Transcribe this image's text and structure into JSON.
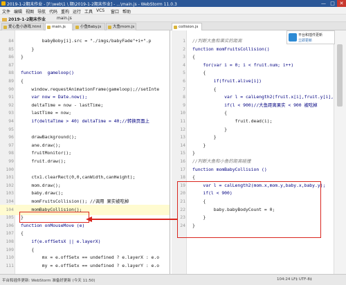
{
  "window": {
    "title": "2019-1-2期末作业 - [F:\\web\\1 \\ 期\\2019-1-2期末作业] - ...\\main.js - WebStorm 11.0.3",
    "minimize": "—",
    "maximize": "□",
    "close": "✕"
  },
  "menu": [
    "文件",
    "编辑",
    "视图",
    "导航",
    "代码",
    "重构",
    "运行",
    "工具",
    "VCS",
    "窗口",
    "帮助"
  ],
  "toolbar": {
    "project": "2019-1-2期末作业",
    "file": "main.js"
  },
  "tabs": [
    {
      "label": "爱心鱼小游戏.html",
      "active": false
    },
    {
      "label": "main.js",
      "active": true
    },
    {
      "label": "小鱼Baby.js",
      "active": false
    },
    {
      "label": "大鱼mom.js",
      "active": false
    },
    {
      "label": "collision.js",
      "active": true
    }
  ],
  "left_code": [
    {
      "n": "84",
      "t": "        babyBoby[i].src = \"./imgs/babyFade\"+i+\".p"
    },
    {
      "n": "85",
      "t": "    }"
    },
    {
      "n": "86",
      "t": "}"
    },
    {
      "n": "87",
      "t": ""
    },
    {
      "n": "88",
      "t": "function  gameloop()"
    },
    {
      "n": "89",
      "t": "{"
    },
    {
      "n": "90",
      "t": "    window.requestAnimationFrame(gameloop);//setInte"
    },
    {
      "n": "91",
      "t": "    var now = Date.now();"
    },
    {
      "n": "92",
      "t": "    deltaTime = now - lastTime;"
    },
    {
      "n": "93",
      "t": "    lastTime = now;"
    },
    {
      "n": "94",
      "t": "    if(deltaTime > 40) deltaTime = 40;//转换页面上"
    },
    {
      "n": "95",
      "t": ""
    },
    {
      "n": "96",
      "t": "    drawBackground();"
    },
    {
      "n": "97",
      "t": "    ane.draw();"
    },
    {
      "n": "98",
      "t": "    fruitMonitor();"
    },
    {
      "n": "99",
      "t": "    fruit.draw();"
    },
    {
      "n": "100",
      "t": ""
    },
    {
      "n": "101",
      "t": "    ctx1.clearRect(0,0,canWidth,canHeight);"
    },
    {
      "n": "102",
      "t": "    mom.draw();"
    },
    {
      "n": "103",
      "t": "    baby.draw();"
    },
    {
      "n": "104",
      "t": "    momFruitsCollision(); //调用 果实被吃掉"
    },
    {
      "n": "104",
      "t": "    momBabyCollision();"
    },
    {
      "n": "105",
      "t": "}"
    },
    {
      "n": "106",
      "t": "function onMouseMove (e)"
    },
    {
      "n": "107",
      "t": "{"
    },
    {
      "n": "108",
      "t": "    if(e.offSetsX || e.layerX)"
    },
    {
      "n": "109",
      "t": "    {"
    },
    {
      "n": "110",
      "t": "        mx = e.offSetx == undefined ? e.layerX : e.o"
    },
    {
      "n": "111",
      "t": "        my = e.offSetx == undefined ? e.layerY : e.o"
    }
  ],
  "right_code": [
    {
      "n": "1",
      "t": "//判断大鱼和果实的距离"
    },
    {
      "n": "2",
      "t": "function momFruitsCollision()"
    },
    {
      "n": "3",
      "t": "{"
    },
    {
      "n": "4",
      "t": "    for(var i = 0; i < fruit.num; i++)"
    },
    {
      "n": "5",
      "t": "    {"
    },
    {
      "n": "6",
      "t": "        if(fruit.alive[i])"
    },
    {
      "n": "7",
      "t": "        {"
    },
    {
      "n": "8",
      "t": "            var l = calLength2(fruit.x[i],fruit.y[i], mom"
    },
    {
      "n": "9",
      "t": "            if(l < 900)//大鱼距离果实 < 900 被吃掉"
    },
    {
      "n": "10",
      "t": "            {"
    },
    {
      "n": "11",
      "t": "                fruit.dead(i);"
    },
    {
      "n": "12",
      "t": "            }"
    },
    {
      "n": "13",
      "t": "        }"
    },
    {
      "n": "14",
      "t": "    }"
    },
    {
      "n": "15",
      "t": "}"
    },
    {
      "n": "16",
      "t": "//判断大鱼和小鱼的距离碰撞"
    },
    {
      "n": "17",
      "t": "function momBabyCollision ()"
    },
    {
      "n": "18",
      "t": "{"
    },
    {
      "n": "19",
      "t": "    var l = calLength2(mom.x,mom.y,baby.x,baby.y);"
    },
    {
      "n": "20",
      "t": "    if(l < 900)"
    },
    {
      "n": "21",
      "t": "    {"
    },
    {
      "n": "22",
      "t": "        baby.babyBodyCount = 0;"
    },
    {
      "n": "23",
      "t": "    }"
    },
    {
      "n": "24",
      "t": "}"
    }
  ],
  "notify": {
    "title": "平台和插件更新",
    "link": "立即更新"
  },
  "status": {
    "left": "平台和插件更新: WebStorm 准备好更新 (今天 11:50)",
    "right": "104:24  LF‡  UTF-8‡"
  },
  "colors": {
    "highlight": "#d9241d",
    "titlebar": "#2b5797"
  }
}
